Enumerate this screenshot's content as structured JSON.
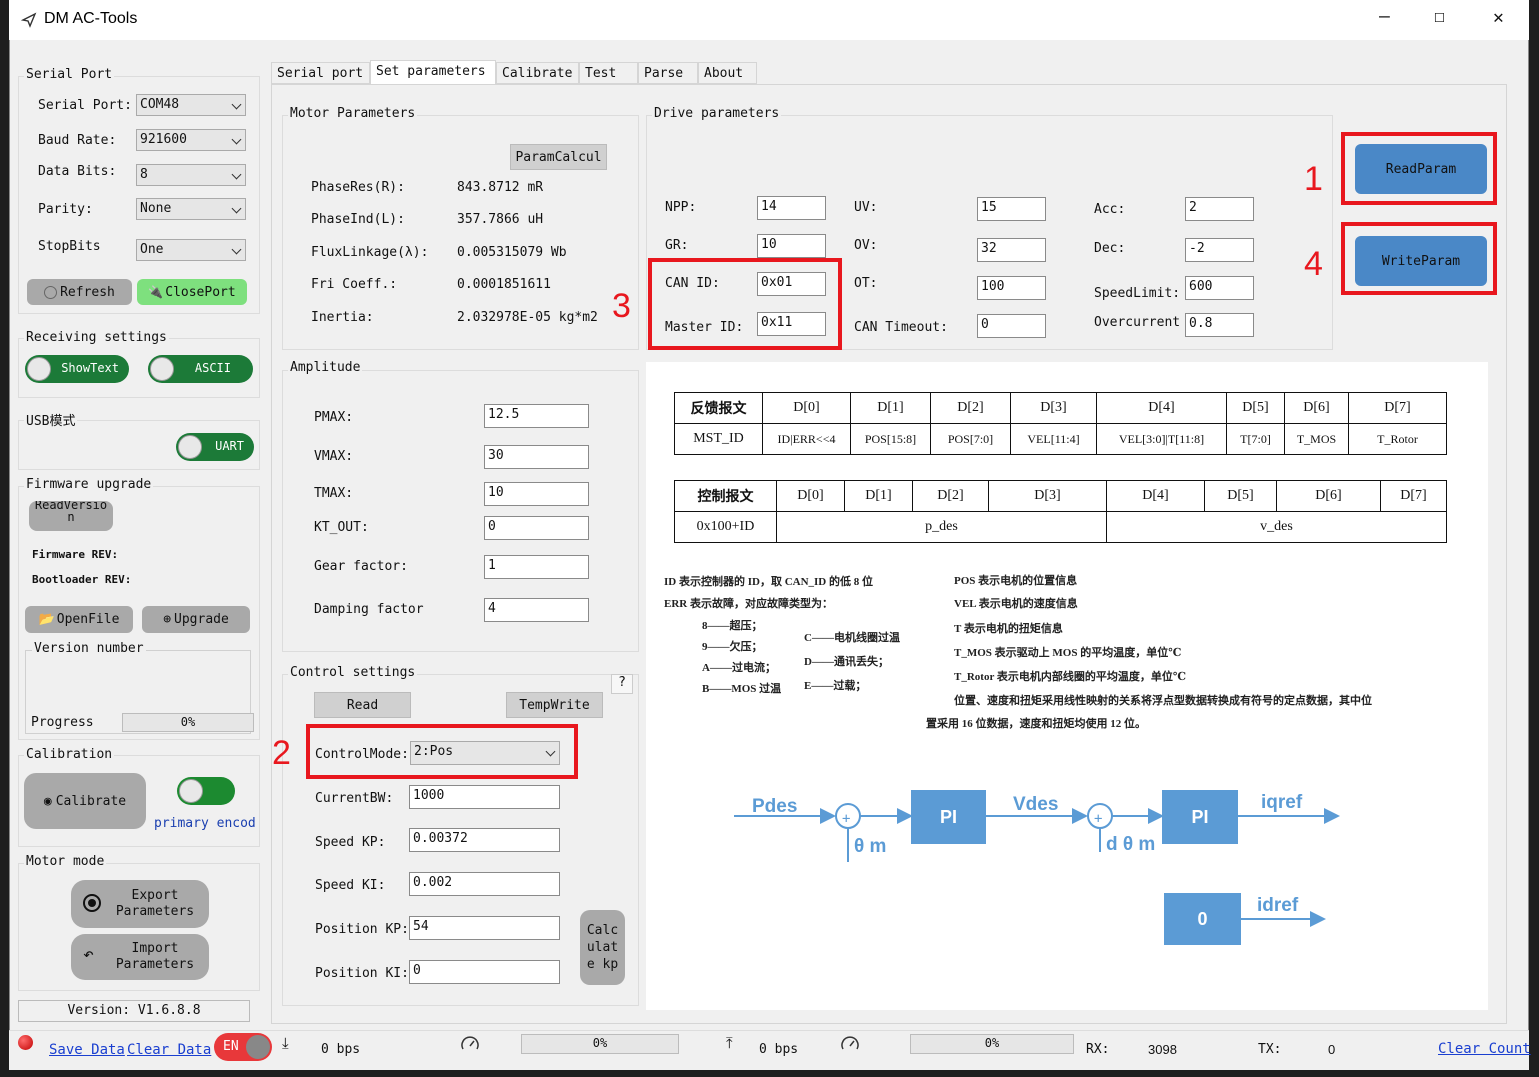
{
  "window": {
    "title": "DM AC-Tools",
    "minimize": "—",
    "maximize": "☐",
    "close": "✕"
  },
  "serial_port": {
    "group_title": "Serial Port",
    "port_label": "Serial Port:",
    "port_value": "COM48",
    "baud_label": "Baud Rate:",
    "baud_value": "921600",
    "databits_label": "Data Bits:",
    "databits_value": "8",
    "parity_label": "Parity:",
    "parity_value": "None",
    "stopbits_label": "StopBits",
    "stopbits_value": "One",
    "refresh_label": "Refresh",
    "closeport_label": "ClosePort"
  },
  "receiving": {
    "group_title": "Receiving settings",
    "showtext_label": "ShowText",
    "ascii_label": "ASCII"
  },
  "usb": {
    "group_title": "USB模式",
    "uart_label": "UART"
  },
  "firmware": {
    "group_title": "Firmware upgrade",
    "readversion_label": "ReadVersio n",
    "firmware_rev": "Firmware REV:",
    "bootloader_rev": "Bootloader REV:",
    "openfile_label": "OpenFile",
    "upgrade_label": "Upgrade",
    "version_number_title": "Version number",
    "progress_label": "Progress",
    "progress_value": "0%"
  },
  "calibration": {
    "group_title": "Calibration",
    "calibrate_label": "Calibrate",
    "encoder_label": "primary encod"
  },
  "motor_mode": {
    "group_title": "Motor mode",
    "export_label": "Export Parameters",
    "import_label": "Import Parameters"
  },
  "version": "Version: V1.6.8.8",
  "tabs": [
    {
      "label": "Serial port"
    },
    {
      "label": "Set parameters"
    },
    {
      "label": "Calibrate"
    },
    {
      "label": "Test"
    },
    {
      "label": "Parse"
    },
    {
      "label": "About"
    }
  ],
  "motor_params": {
    "group_title": "Motor Parameters",
    "paramcalc_label": "ParamCalcul",
    "rows": [
      {
        "label": "PhaseRes(R):",
        "value": "843.8712 mR"
      },
      {
        "label": "PhaseInd(L):",
        "value": "357.7866 uH"
      },
      {
        "label": "FluxLinkage(λ):",
        "value": "0.005315079 Wb"
      },
      {
        "label": "Fri Coeff.:",
        "value": "0.0001851611"
      },
      {
        "label": "Inertia:",
        "value": "2.032978E-05 kg*m2"
      }
    ]
  },
  "drive_params": {
    "group_title": "Drive parameters",
    "npp_label": "NPP:",
    "npp_value": "14",
    "gr_label": "GR:",
    "gr_value": "10",
    "canid_label": "CAN ID:",
    "canid_value": "0x01",
    "masterid_label": "Master ID:",
    "masterid_value": "0x11",
    "uv_label": "UV:",
    "uv_value": "15",
    "ov_label": "OV:",
    "ov_value": "32",
    "ot_label": "OT:",
    "ot_value": "100",
    "cantimeout_label": "CAN Timeout:",
    "cantimeout_value": "0",
    "acc_label": "Acc:",
    "acc_value": "2",
    "dec_label": "Dec:",
    "dec_value": "-2",
    "speedlimit_label": "SpeedLimit:",
    "speedlimit_value": "600",
    "overcurrent_label": "Overcurrent",
    "overcurrent_value": "0.8"
  },
  "actions": {
    "readparam_label": "ReadParam",
    "writeparam_label": "WriteParam"
  },
  "annotations": {
    "n1": "1",
    "n2": "2",
    "n3": "3",
    "n4": "4"
  },
  "amplitude": {
    "group_title": "Amplitude",
    "rows": [
      {
        "label": "PMAX:",
        "value": "12.5"
      },
      {
        "label": "VMAX:",
        "value": "30"
      },
      {
        "label": "TMAX:",
        "value": "10"
      },
      {
        "label": "KT_OUT:",
        "value": "0"
      },
      {
        "label": "Gear factor:",
        "value": "1"
      },
      {
        "label": "Damping factor",
        "value": "4"
      }
    ]
  },
  "control": {
    "group_title": "Control settings",
    "help": "?",
    "read_label": "Read",
    "tempwrite_label": "TempWrite",
    "mode_label": "ControlMode:",
    "mode_value": "2:Pos",
    "currentbw_label": "CurrentBW:",
    "currentbw_value": "1000",
    "speedkp_label": "Speed KP:",
    "speedkp_value": "0.00372",
    "speedki_label": "Speed KI:",
    "speedki_value": "0.002",
    "poskp_label": "Position KP:",
    "poskp_value": "54",
    "poski_label": "Position KI:",
    "poski_value": "0",
    "calckp_label": "Calc ulat e kp"
  },
  "protocol": {
    "feedback_header": [
      "反馈报文",
      "D[0]",
      "D[1]",
      "D[2]",
      "D[3]",
      "D[4]",
      "D[5]",
      "D[6]",
      "D[7]"
    ],
    "feedback_row": [
      "MST_ID",
      "ID|ERR<<4",
      "POS[15:8]",
      "POS[7:0]",
      "VEL[11:4]",
      "VEL[3:0]|T[11:8]",
      "T[7:0]",
      "T_MOS",
      "T_Rotor"
    ],
    "control_header": [
      "控制报文",
      "D[0]",
      "D[1]",
      "D[2]",
      "D[3]",
      "D[4]",
      "D[5]",
      "D[6]",
      "D[7]"
    ],
    "control_row": [
      "0x100+ID",
      "p_des",
      "v_des"
    ],
    "notes_left": [
      "ID 表示控制器的 ID，取 CAN_ID 的低 8 位",
      "ERR 表示故障，对应故障类型为："
    ],
    "faults_a": [
      "8——超压；",
      "9——欠压；",
      "A——过电流；",
      "B——MOS 过温"
    ],
    "faults_b": [
      "C——电机线圈过温",
      "D——通讯丢失；",
      "E——过载；"
    ],
    "notes_right": [
      "POS 表示电机的位置信息",
      "VEL 表示电机的速度信息",
      "T 表示电机的扭矩信息",
      "T_MOS 表示驱动上 MOS 的平均温度，单位℃",
      "T_Rotor 表示电机内部线圈的平均温度，单位℃",
      "位置、速度和扭矩采用线性映射的关系将浮点型数据转换成有符号的定点数据，其中位",
      "置采用 16 位数据，速度和扭矩均使用 12 位。"
    ],
    "diagram": {
      "pdes": "Pdes",
      "pi1": "PI",
      "vdes": "Vdes",
      "pi2": "PI",
      "iqref": "iqref",
      "theta_m": "θ m",
      "dtheta_m": "d θ m",
      "zero": "0",
      "idref": "idref"
    }
  },
  "statusbar": {
    "save_data": "Save Data",
    "clear_data": "Clear Data",
    "lang": "EN",
    "rx_bps": "0 bps",
    "rx_progress": "0%",
    "tx_bps": "0 bps",
    "tx_progress": "0%",
    "rx_label": "RX:",
    "rx_value": "3098",
    "tx_label": "TX:",
    "tx_value": "0",
    "clear_count": "Clear Count"
  }
}
